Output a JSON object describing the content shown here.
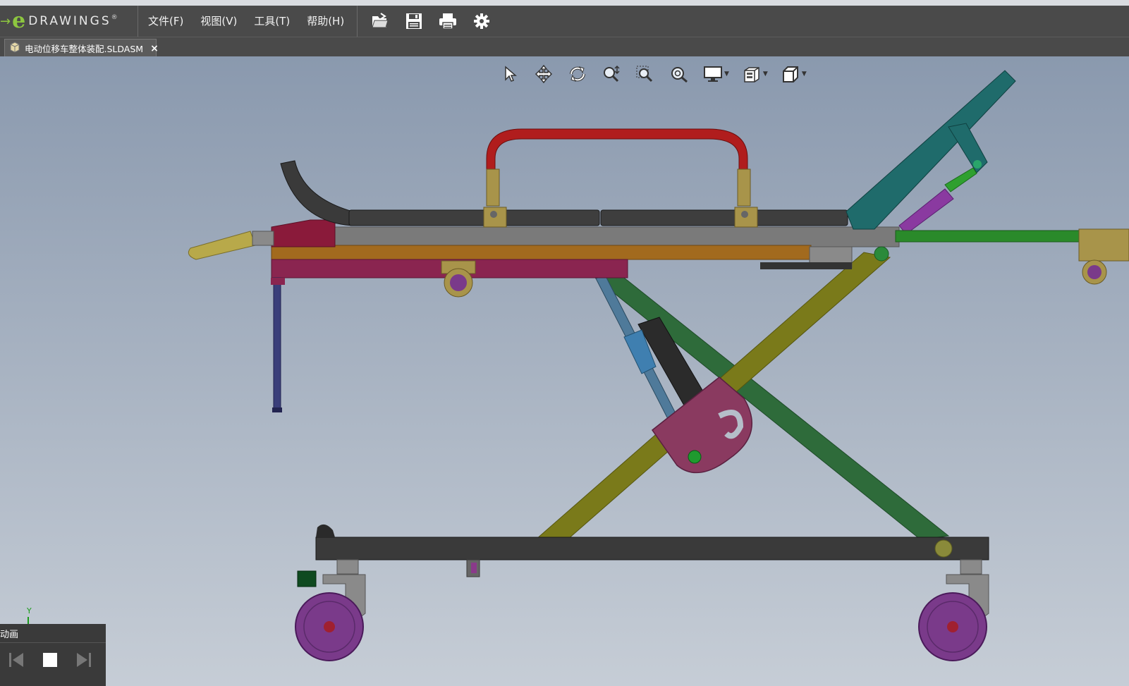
{
  "app": {
    "logo_letter": "e",
    "logo_text": "DRAWINGS",
    "logo_mark": "®"
  },
  "menu": {
    "items": [
      {
        "label": "文件(F)"
      },
      {
        "label": "视图(V)"
      },
      {
        "label": "工具(T)"
      },
      {
        "label": "帮助(H)"
      }
    ]
  },
  "toolbar": {
    "icons": [
      "open-folder-icon",
      "save-icon",
      "print-icon",
      "settings-gear-icon"
    ]
  },
  "tabs": [
    {
      "label": "电动位移车整体装配.SLDASM",
      "close": "×",
      "icon": "assembly-icon"
    }
  ],
  "heads_up_toolbar": {
    "icons": [
      "select-arrow-icon",
      "pan-icon",
      "rotate-icon",
      "zoom-icon",
      "zoom-to-area-icon",
      "zoom-to-fit-icon",
      "display-style-icon",
      "sectioning-icon",
      "view-orientation-icon"
    ]
  },
  "triad": {
    "y_label": "Y"
  },
  "animation": {
    "title": "动画",
    "buttons": [
      "rewind-icon",
      "stop-icon",
      "step-forward-icon"
    ]
  },
  "colors": {
    "menubar": "#4a4a4a",
    "accent_green": "#8dc63f",
    "viewport_top": "#8a99ae",
    "viewport_bottom": "#c6cdd6"
  }
}
